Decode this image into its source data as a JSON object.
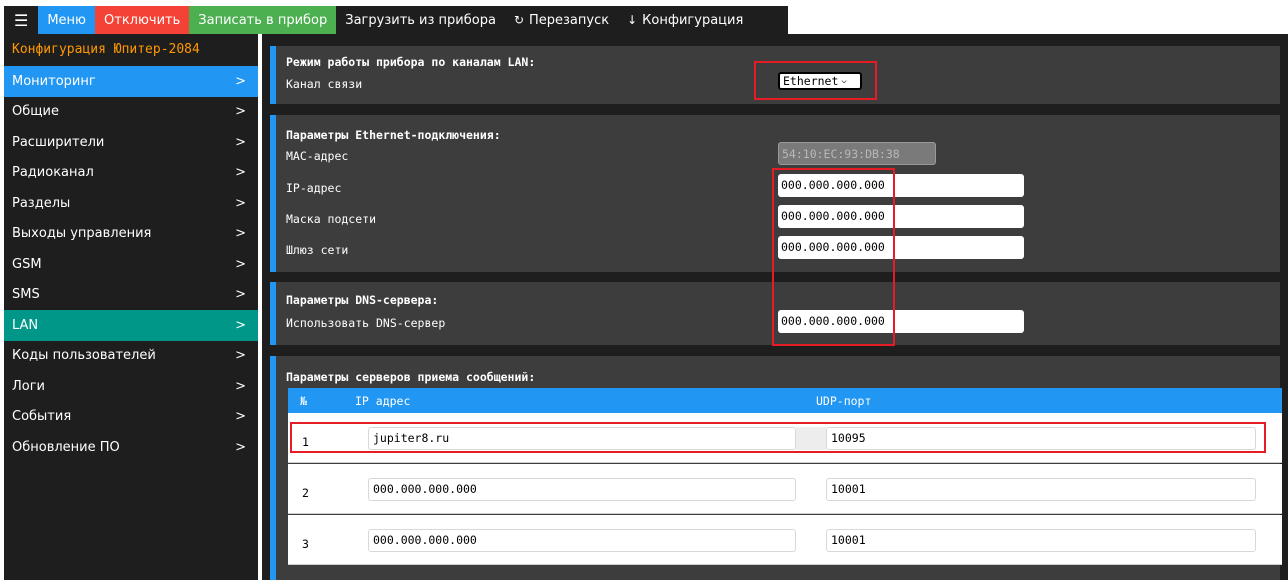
{
  "topbar": {
    "menu_icon": "☰",
    "menu": "Меню",
    "disconnect": "Отключить",
    "write": "Записать в прибор",
    "load": "Загрузить из прибора",
    "restart": "Перезапуск",
    "restart_icon": "↻",
    "config": "Конфигурация",
    "config_icon": "↓"
  },
  "sidebar": {
    "title": "Конфигурация Юпитер-2084",
    "arrow": ">",
    "items": [
      {
        "label": "Мониторинг"
      },
      {
        "label": "Общие"
      },
      {
        "label": "Расширители"
      },
      {
        "label": "Радиоканал"
      },
      {
        "label": "Разделы"
      },
      {
        "label": "Выходы управления"
      },
      {
        "label": "GSM"
      },
      {
        "label": "SMS"
      },
      {
        "label": "LAN"
      },
      {
        "label": "Коды пользователей"
      },
      {
        "label": "Логи"
      },
      {
        "label": "События"
      },
      {
        "label": "Обновление ПО"
      }
    ]
  },
  "lan_mode": {
    "title": "Режим работы прибора по каналам LAN:",
    "channel_label": "Канал связи",
    "channel_value": "Ethernet"
  },
  "ethernet": {
    "title": "Параметры Ethernet-подключения:",
    "mac_label": "MAC-адрес",
    "mac_value": "54:10:EC:93:DB:38",
    "ip_label": "IP-адрес",
    "ip_value": "000.000.000.000",
    "mask_label": "Маска подсети",
    "mask_value": "000.000.000.000",
    "gateway_label": "Шлюз сети",
    "gateway_value": "000.000.000.000"
  },
  "dns": {
    "title": "Параметры DNS-сервера:",
    "use_label": "Использовать DNS-сервер",
    "use_value": "000.000.000.000"
  },
  "servers": {
    "title": "Параметры серверов приема сообщений:",
    "columns": {
      "num": "№",
      "ip": "IP адрес",
      "port": "UDP-порт"
    },
    "rows": [
      {
        "num": "1",
        "ip": "jupiter8.ru",
        "port": "10095"
      },
      {
        "num": "2",
        "ip": "000.000.000.000",
        "port": "10001"
      },
      {
        "num": "3",
        "ip": "000.000.000.000",
        "port": "10001"
      }
    ]
  }
}
